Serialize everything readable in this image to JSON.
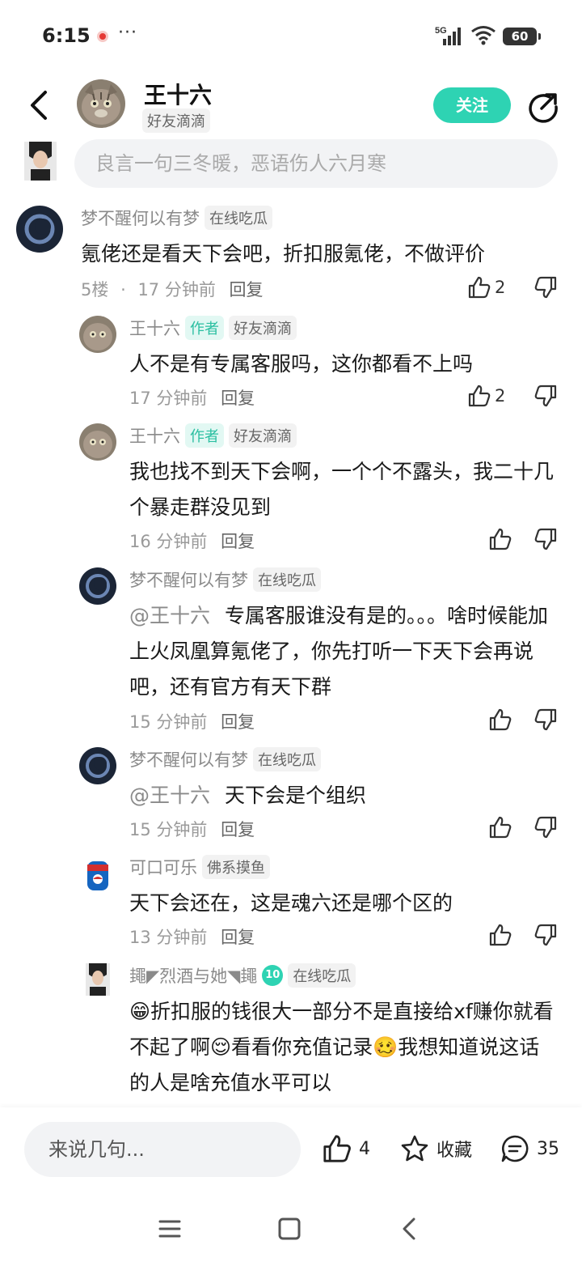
{
  "status": {
    "time": "6:15",
    "more": "···",
    "network": "5G",
    "battery": "60"
  },
  "header": {
    "name": "王十六",
    "tag": "好友滴滴",
    "follow_label": "关注"
  },
  "reply_bar": {
    "placeholder": "良言一句三冬暖，恶语伤人六月寒"
  },
  "comments": [
    {
      "name": "梦不醒何以有梦",
      "tag": "在线吃瓜",
      "text": "氪佬还是看天下会吧，折扣服氪佬，不做评价",
      "floor": "5楼",
      "time": "17 分钟前",
      "reply": "回复",
      "likes": "2"
    },
    {
      "name": "王十六",
      "author": "作者",
      "tag": "好友滴滴",
      "text": "人不是有专属客服吗，这你都看不上吗",
      "time": "17 分钟前",
      "reply": "回复",
      "likes": "2"
    },
    {
      "name": "王十六",
      "author": "作者",
      "tag": "好友滴滴",
      "text": "我也找不到天下会啊，一个个不露头，我二十几个暴走群没见到",
      "time": "16 分钟前",
      "reply": "回复"
    },
    {
      "name": "梦不醒何以有梦",
      "tag": "在线吃瓜",
      "mention": "@王十六",
      "text": "专属客服谁没有是的。。。啥时候能加上火凤凰算氪佬了，你先打听一下天下会再说吧，还有官方有天下群",
      "time": "15 分钟前",
      "reply": "回复"
    },
    {
      "name": "梦不醒何以有梦",
      "tag": "在线吃瓜",
      "mention": "@王十六",
      "text": "天下会是个组织",
      "time": "15 分钟前",
      "reply": "回复"
    },
    {
      "name": "可口可乐",
      "tag": "佛系摸鱼",
      "text": "天下会还在，这是魂六还是哪个区的",
      "time": "13 分钟前",
      "reply": "回复"
    },
    {
      "name": "䵷◤烈酒与她◥䵷",
      "level": "10",
      "tag": "在线吃瓜",
      "text": "😁折扣服的钱很大一部分不是直接给xf赚你就看不起了啊😌看看你充值记录🥴我想知道说这话的人是啥充值水平可以"
    }
  ],
  "bottom_bar": {
    "placeholder": "来说几句...",
    "likes": "4",
    "favorite": "收藏",
    "comments": "35"
  },
  "colors": {
    "accent": "#2ed3b3",
    "author_tag_bg": "#e2f8f3"
  }
}
